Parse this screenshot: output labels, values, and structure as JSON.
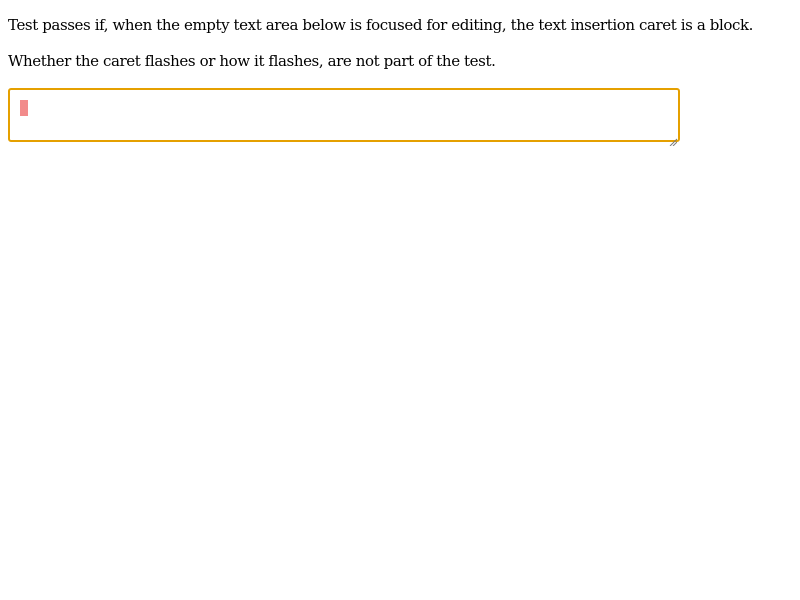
{
  "instructions": {
    "line1": "Test passes if, when the empty text area below is focused for editing, the text insertion caret is a block.",
    "line2": "Whether the caret flashes or how it flashes, are not part of the test."
  },
  "textarea": {
    "value": "",
    "focused": true,
    "caret_style": "block",
    "focus_border_color": "#e5a000",
    "caret_color": "#f28b8b"
  },
  "icons": {
    "resize_grip": "resize-grip-icon"
  }
}
